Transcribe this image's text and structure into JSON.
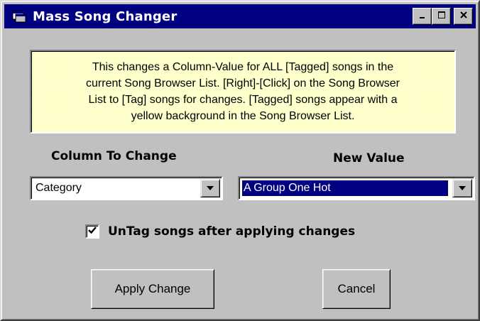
{
  "window": {
    "title": "Mass Song Changer",
    "icon": "app-window-icon",
    "controls": {
      "minimize_icon": "minimize-icon",
      "maximize_icon": "maximize-icon",
      "close_icon": "close-icon"
    }
  },
  "info": {
    "line1": "This changes a  Column-Value for ALL [Tagged] songs in the",
    "line2": "current Song Browser List.   [Right]-[Click] on the Song Browser",
    "line3": "List to [Tag] songs for changes.   [Tagged] songs appear with a",
    "line4": "yellow background in the Song Browser List."
  },
  "column_to_change": {
    "label": "Column To Change",
    "selected": "Category"
  },
  "new_value": {
    "label": "New Value",
    "selected": "A Group One Hot"
  },
  "untag": {
    "label": "UnTag songs after applying changes",
    "checked": true
  },
  "buttons": {
    "apply": "Apply Change",
    "cancel": "Cancel"
  },
  "colors": {
    "titlebar": "#000080",
    "face": "#c0c0c0",
    "info_background": "#ffffc8",
    "selection": "#000080"
  }
}
